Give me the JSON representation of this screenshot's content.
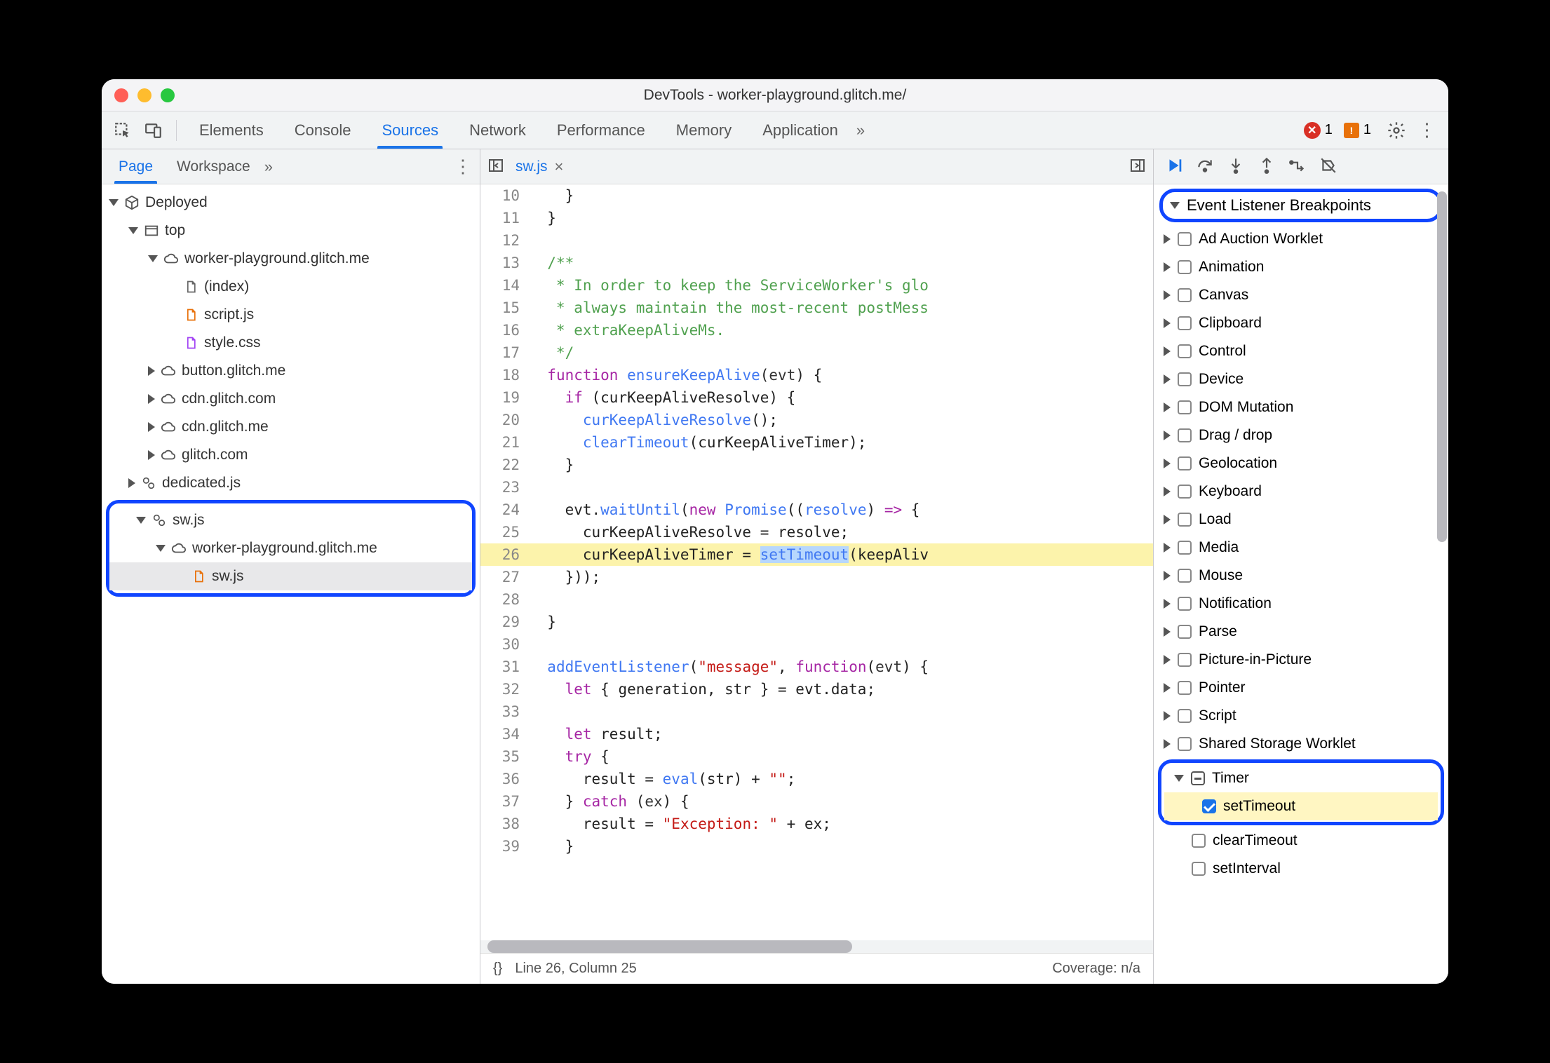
{
  "window": {
    "title": "DevTools - worker-playground.glitch.me/"
  },
  "topTabs": {
    "items": [
      "Elements",
      "Console",
      "Sources",
      "Network",
      "Performance",
      "Memory",
      "Application"
    ],
    "active": "Sources",
    "overflow": "»",
    "errors": "1",
    "warns": "1"
  },
  "leftPanel": {
    "tabs": [
      "Page",
      "Workspace"
    ],
    "active": "Page",
    "overflow": "»",
    "tree": {
      "deployed": "Deployed",
      "top": "top",
      "wpg": "worker-playground.glitch.me",
      "index": "(index)",
      "scriptjs": "script.js",
      "stylecss": "style.css",
      "button": "button.glitch.me",
      "cdn1": "cdn.glitch.com",
      "cdn2": "cdn.glitch.me",
      "glitch": "glitch.com",
      "dedicated": "dedicated.js",
      "swjsRoot": "sw.js",
      "wpg2": "worker-playground.glitch.me",
      "swjsFile": "sw.js"
    }
  },
  "editor": {
    "file": "sw.js",
    "startLine": 10,
    "lines": [
      {
        "n": 10,
        "segs": [
          {
            "t": "    }"
          }
        ]
      },
      {
        "n": 11,
        "segs": [
          {
            "t": "  }"
          }
        ]
      },
      {
        "n": 12,
        "segs": [
          {
            "t": ""
          }
        ]
      },
      {
        "n": 13,
        "segs": [
          {
            "t": "  ",
            "c": ""
          },
          {
            "t": "/**",
            "c": "cmt"
          }
        ]
      },
      {
        "n": 14,
        "segs": [
          {
            "t": "   * In order to keep the ServiceWorker's glo",
            "c": "cmt"
          }
        ]
      },
      {
        "n": 15,
        "segs": [
          {
            "t": "   * always maintain the most-recent postMess",
            "c": "cmt"
          }
        ]
      },
      {
        "n": 16,
        "segs": [
          {
            "t": "   * extraKeepAliveMs.",
            "c": "cmt"
          }
        ]
      },
      {
        "n": 17,
        "segs": [
          {
            "t": "   */",
            "c": "cmt"
          }
        ]
      },
      {
        "n": 18,
        "segs": [
          {
            "t": "  "
          },
          {
            "t": "function ",
            "c": "kw"
          },
          {
            "t": "ensureKeepAlive",
            "c": "func"
          },
          {
            "t": "("
          },
          {
            "t": "evt",
            "c": "id"
          },
          {
            "t": ") {"
          }
        ]
      },
      {
        "n": 19,
        "segs": [
          {
            "t": "    "
          },
          {
            "t": "if ",
            "c": "kw"
          },
          {
            "t": "(curKeepAliveResolve) {"
          }
        ]
      },
      {
        "n": 20,
        "segs": [
          {
            "t": "      "
          },
          {
            "t": "curKeepAliveResolve",
            "c": "func"
          },
          {
            "t": "();"
          }
        ]
      },
      {
        "n": 21,
        "segs": [
          {
            "t": "      "
          },
          {
            "t": "clearTimeout",
            "c": "func"
          },
          {
            "t": "(curKeepAliveTimer);"
          }
        ]
      },
      {
        "n": 22,
        "segs": [
          {
            "t": "    }"
          }
        ]
      },
      {
        "n": 23,
        "segs": [
          {
            "t": ""
          }
        ]
      },
      {
        "n": 24,
        "segs": [
          {
            "t": "    evt."
          },
          {
            "t": "waitUntil",
            "c": "func"
          },
          {
            "t": "("
          },
          {
            "t": "new ",
            "c": "kw"
          },
          {
            "t": "Promise",
            "c": "func"
          },
          {
            "t": "(("
          },
          {
            "t": "resolve",
            "c": "func"
          },
          {
            "t": ") "
          },
          {
            "t": "=>",
            "c": "kw"
          },
          {
            "t": " {"
          }
        ]
      },
      {
        "n": 25,
        "segs": [
          {
            "t": "      curKeepAliveResolve = resolve;"
          }
        ]
      },
      {
        "n": 26,
        "hl": true,
        "segs": [
          {
            "t": "      curKeepAliveTimer = "
          },
          {
            "t": "setTimeout",
            "c": "func sel-span"
          },
          {
            "t": "(keepAliv"
          }
        ]
      },
      {
        "n": 27,
        "segs": [
          {
            "t": "    }));"
          }
        ]
      },
      {
        "n": 28,
        "segs": [
          {
            "t": ""
          }
        ]
      },
      {
        "n": 29,
        "segs": [
          {
            "t": "  }"
          }
        ]
      },
      {
        "n": 30,
        "segs": [
          {
            "t": ""
          }
        ]
      },
      {
        "n": 31,
        "segs": [
          {
            "t": "  "
          },
          {
            "t": "addEventListener",
            "c": "func"
          },
          {
            "t": "("
          },
          {
            "t": "\"message\"",
            "c": "str"
          },
          {
            "t": ", "
          },
          {
            "t": "function",
            "c": "kw"
          },
          {
            "t": "("
          },
          {
            "t": "evt",
            "c": "id"
          },
          {
            "t": ") {"
          }
        ]
      },
      {
        "n": 32,
        "segs": [
          {
            "t": "    "
          },
          {
            "t": "let ",
            "c": "kw"
          },
          {
            "t": "{ generation, str } = evt.data;"
          }
        ]
      },
      {
        "n": 33,
        "segs": [
          {
            "t": ""
          }
        ]
      },
      {
        "n": 34,
        "segs": [
          {
            "t": "    "
          },
          {
            "t": "let ",
            "c": "kw"
          },
          {
            "t": "result;"
          }
        ]
      },
      {
        "n": 35,
        "segs": [
          {
            "t": "    "
          },
          {
            "t": "try ",
            "c": "kw"
          },
          {
            "t": "{"
          }
        ]
      },
      {
        "n": 36,
        "segs": [
          {
            "t": "      result = "
          },
          {
            "t": "eval",
            "c": "func"
          },
          {
            "t": "(str) + "
          },
          {
            "t": "\"\"",
            "c": "str"
          },
          {
            "t": ";"
          }
        ]
      },
      {
        "n": 37,
        "segs": [
          {
            "t": "    } "
          },
          {
            "t": "catch ",
            "c": "kw"
          },
          {
            "t": "("
          },
          {
            "t": "ex",
            "c": "id"
          },
          {
            "t": ") {"
          }
        ]
      },
      {
        "n": 38,
        "segs": [
          {
            "t": "      result = "
          },
          {
            "t": "\"Exception: \"",
            "c": "str"
          },
          {
            "t": " + ex;"
          }
        ]
      },
      {
        "n": 39,
        "segs": [
          {
            "t": "    }"
          }
        ]
      }
    ],
    "status": {
      "braces": "{}",
      "pos": "Line 26, Column 25",
      "coverage": "Coverage: n/a"
    }
  },
  "right": {
    "sectionTitle": "Event Listener Breakpoints",
    "cats": [
      "Ad Auction Worklet",
      "Animation",
      "Canvas",
      "Clipboard",
      "Control",
      "Device",
      "DOM Mutation",
      "Drag / drop",
      "Geolocation",
      "Keyboard",
      "Load",
      "Media",
      "Mouse",
      "Notification",
      "Parse",
      "Picture-in-Picture",
      "Pointer",
      "Script",
      "Shared Storage Worklet"
    ],
    "timer": {
      "label": "Timer",
      "children": [
        "setTimeout",
        "clearTimeout",
        "setInterval"
      ],
      "checked": "setTimeout"
    }
  }
}
